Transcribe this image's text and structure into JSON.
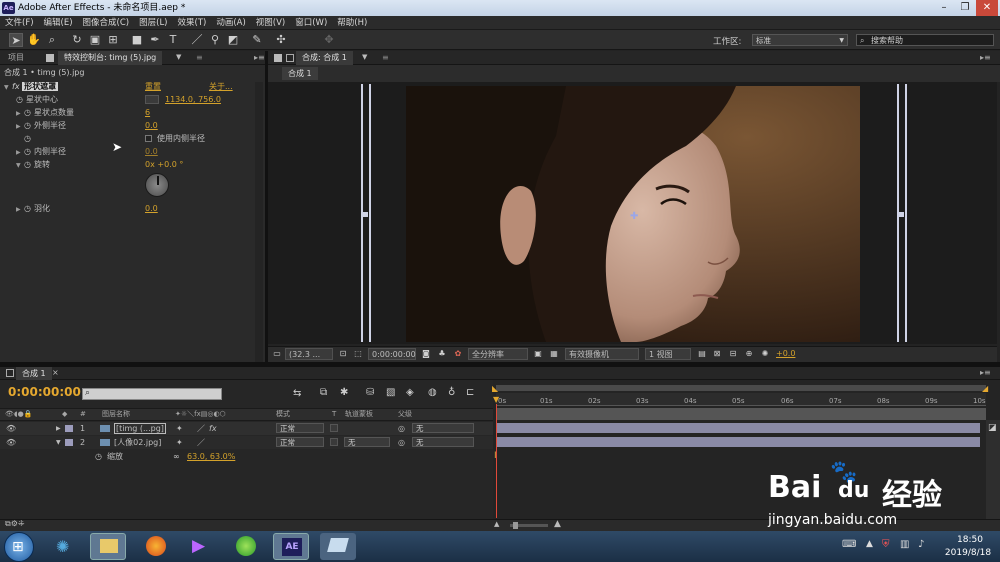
{
  "window": {
    "title": "Adobe After Effects - 未命名项目.aep *",
    "logo": "Ae"
  },
  "menu": [
    "文件(F)",
    "编辑(E)",
    "图像合成(C)",
    "图层(L)",
    "效果(T)",
    "动画(A)",
    "视图(V)",
    "窗口(W)",
    "帮助(H)"
  ],
  "toolbar": {
    "workspace_label": "工作区:",
    "workspace_value": "标准",
    "search_placeholder": "搜索帮助"
  },
  "left_panel": {
    "tab_project": "项目",
    "tab_effects": "特效控制台: timg (5).jpg",
    "breadcrumb": "合成 1 • timg (5).jpg",
    "effect_name": "形状遮罩",
    "reset": "重置",
    "about": "关于...",
    "props": [
      {
        "label": "星状中心",
        "value": "1134.0, 756.0"
      },
      {
        "label": "星状点数量",
        "value": "6"
      },
      {
        "label": "外侧半径",
        "value": "0.0"
      },
      {
        "label": "使用内侧半径",
        "value": ""
      },
      {
        "label": "内侧半径",
        "value": "0.0"
      },
      {
        "label": "旋转",
        "value": "0x +0.0 °"
      },
      {
        "label": "羽化",
        "value": "0.0"
      }
    ]
  },
  "comp_panel": {
    "tab": "合成: 合成 1",
    "subtab": "合成 1",
    "zoom": "(32.3 ...",
    "timecode": "0:00:00:00",
    "resolution": "全分辨率",
    "camera": "有效摄像机",
    "views": "1 视图",
    "exposure": "+0.0"
  },
  "timeline": {
    "tab": "合成 1",
    "timecode": "0:00:00:00",
    "col_headers": {
      "name": "图层名称",
      "mode": "模式",
      "t": "T",
      "trackmatte": "轨道蒙板",
      "parent": "父级"
    },
    "ruler": [
      "0s",
      "01s",
      "02s",
      "03s",
      "04s",
      "05s",
      "06s",
      "07s",
      "08s",
      "09s",
      "10s"
    ],
    "layers": [
      {
        "num": "1",
        "name": "[timg (...pg]",
        "mode": "正常",
        "matte": "",
        "parent": "无"
      },
      {
        "num": "2",
        "name": "[人像02.jpg]",
        "mode": "正常",
        "matte": "无",
        "parent": "无"
      }
    ],
    "scale_label": "缩放",
    "scale_value": "63.0, 63.0%"
  },
  "taskbar": {
    "time": "18:50",
    "date": "2019/8/18",
    "ae_label": "AE"
  },
  "watermark": {
    "brand_a": "Bai",
    "brand_b": "du",
    "cn": "经验",
    "url": "jingyan.baidu.com"
  },
  "colors": {
    "accent_orange": "#d4a22b",
    "playhead": "#e0493a",
    "layer_bar": "#8a8aa6",
    "taskbar": "#1b2f45"
  }
}
